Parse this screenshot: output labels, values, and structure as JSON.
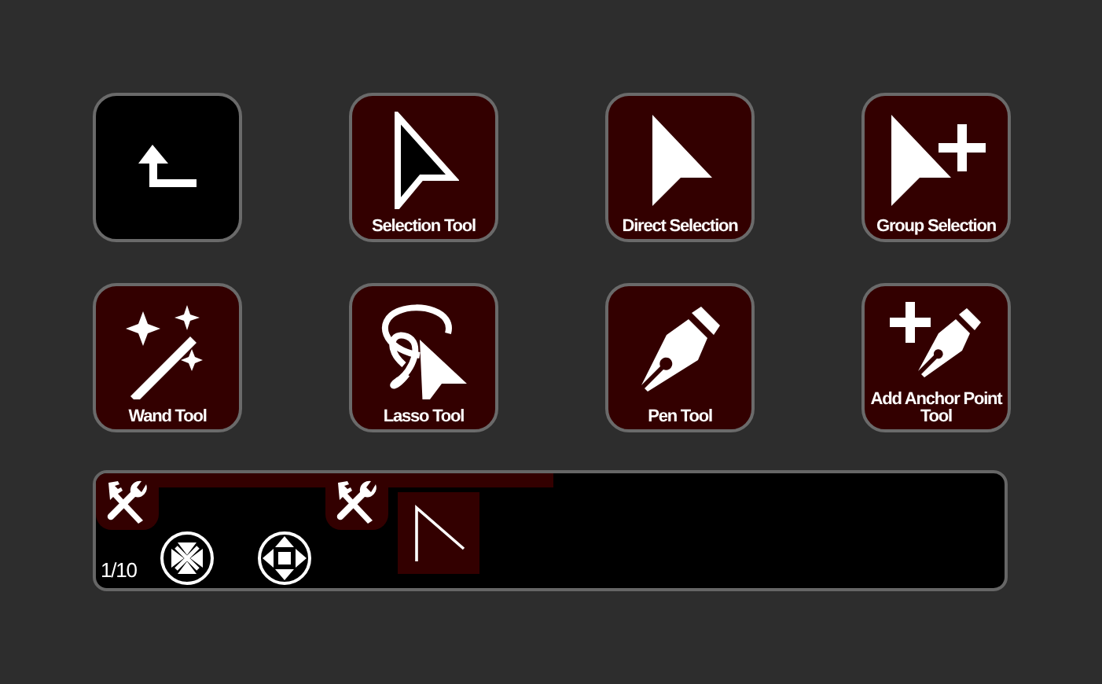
{
  "buttons": [
    {
      "kind": "back"
    },
    {
      "kind": "selection",
      "label": "Selection Tool"
    },
    {
      "kind": "direct",
      "label": "Direct Selection"
    },
    {
      "kind": "group",
      "label": "Group Selection"
    },
    {
      "kind": "wand",
      "label": "Wand Tool"
    },
    {
      "kind": "lasso",
      "label": "Lasso Tool"
    },
    {
      "kind": "pen",
      "label": "Pen Tool"
    },
    {
      "kind": "anchor",
      "label": "Add Anchor Point Tool"
    }
  ],
  "tray": {
    "page": "1/10"
  }
}
